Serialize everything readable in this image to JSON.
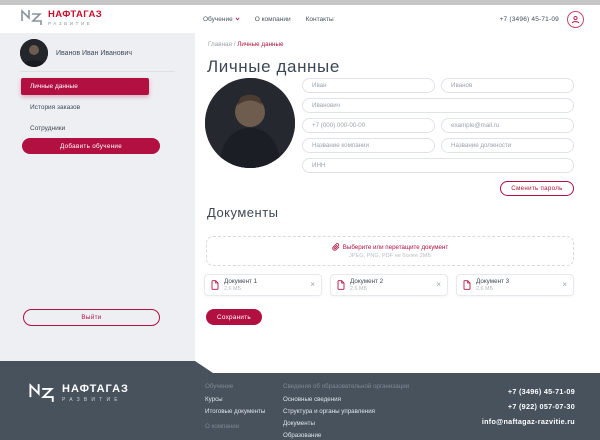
{
  "colors": {
    "accent": "#b11041",
    "logo_red": "#c8102e",
    "footer_bg": "#47525d"
  },
  "header": {
    "logo": {
      "name": "НАФТАГАЗ",
      "subtitle": "РАЗВИТИЕ"
    },
    "nav": [
      {
        "label": "Обучение"
      },
      {
        "label": "О компании"
      },
      {
        "label": "Контакты"
      }
    ],
    "phone": "+7 (3496) 45-71-09"
  },
  "sidebar": {
    "user_name": "Иванов Иван Иванович",
    "items": [
      {
        "label": "Личные данные"
      },
      {
        "label": "История заказов"
      },
      {
        "label": "Сотрудники"
      }
    ],
    "add_training_label": "Добавить обучение",
    "logout_label": "Выйти"
  },
  "breadcrumb": {
    "home": "Главная",
    "separator": " / ",
    "current": "Личные данные"
  },
  "profile": {
    "title": "Личные данные",
    "fields": {
      "first_name": "Иван",
      "last_name": "Иванов",
      "middle_name": "Иванович",
      "phone_placeholder": "+7 (000) 000-00-00",
      "email_placeholder": "example@mail.ru",
      "company_placeholder": "Название компании",
      "position_placeholder": "Название должности",
      "inn_placeholder": "ИНН"
    },
    "change_password_label": "Сменить пароль"
  },
  "documents": {
    "title": "Документы",
    "dropzone_text": "Выберите или перетащите документ",
    "dropzone_hint": "JPEG, PNG, PDF не более 2МБ",
    "files": [
      {
        "name": "Документ 1",
        "size": "2,6 МБ"
      },
      {
        "name": "Документ 2",
        "size": "2,6 МБ"
      },
      {
        "name": "Документ 3",
        "size": "2,6 МБ"
      }
    ],
    "save_label": "Сохранить"
  },
  "footer": {
    "logo": {
      "name": "НАФТАГАЗ",
      "subtitle": "РАЗВИТИЕ"
    },
    "col1": {
      "header": "Обучение",
      "links": [
        "Курсы",
        "Итоговые документы"
      ],
      "header2": "О компании"
    },
    "col2": {
      "header": "Сведения об образовательной организации",
      "links": [
        "Основные сведения",
        "Структура и органы управления",
        "Документы",
        "Образование"
      ]
    },
    "contacts": {
      "phone1": "+7 (3496) 45-71-09",
      "phone2": "+7 (922) 057-07-30",
      "email": "info@naftagaz-razvitie.ru"
    }
  }
}
